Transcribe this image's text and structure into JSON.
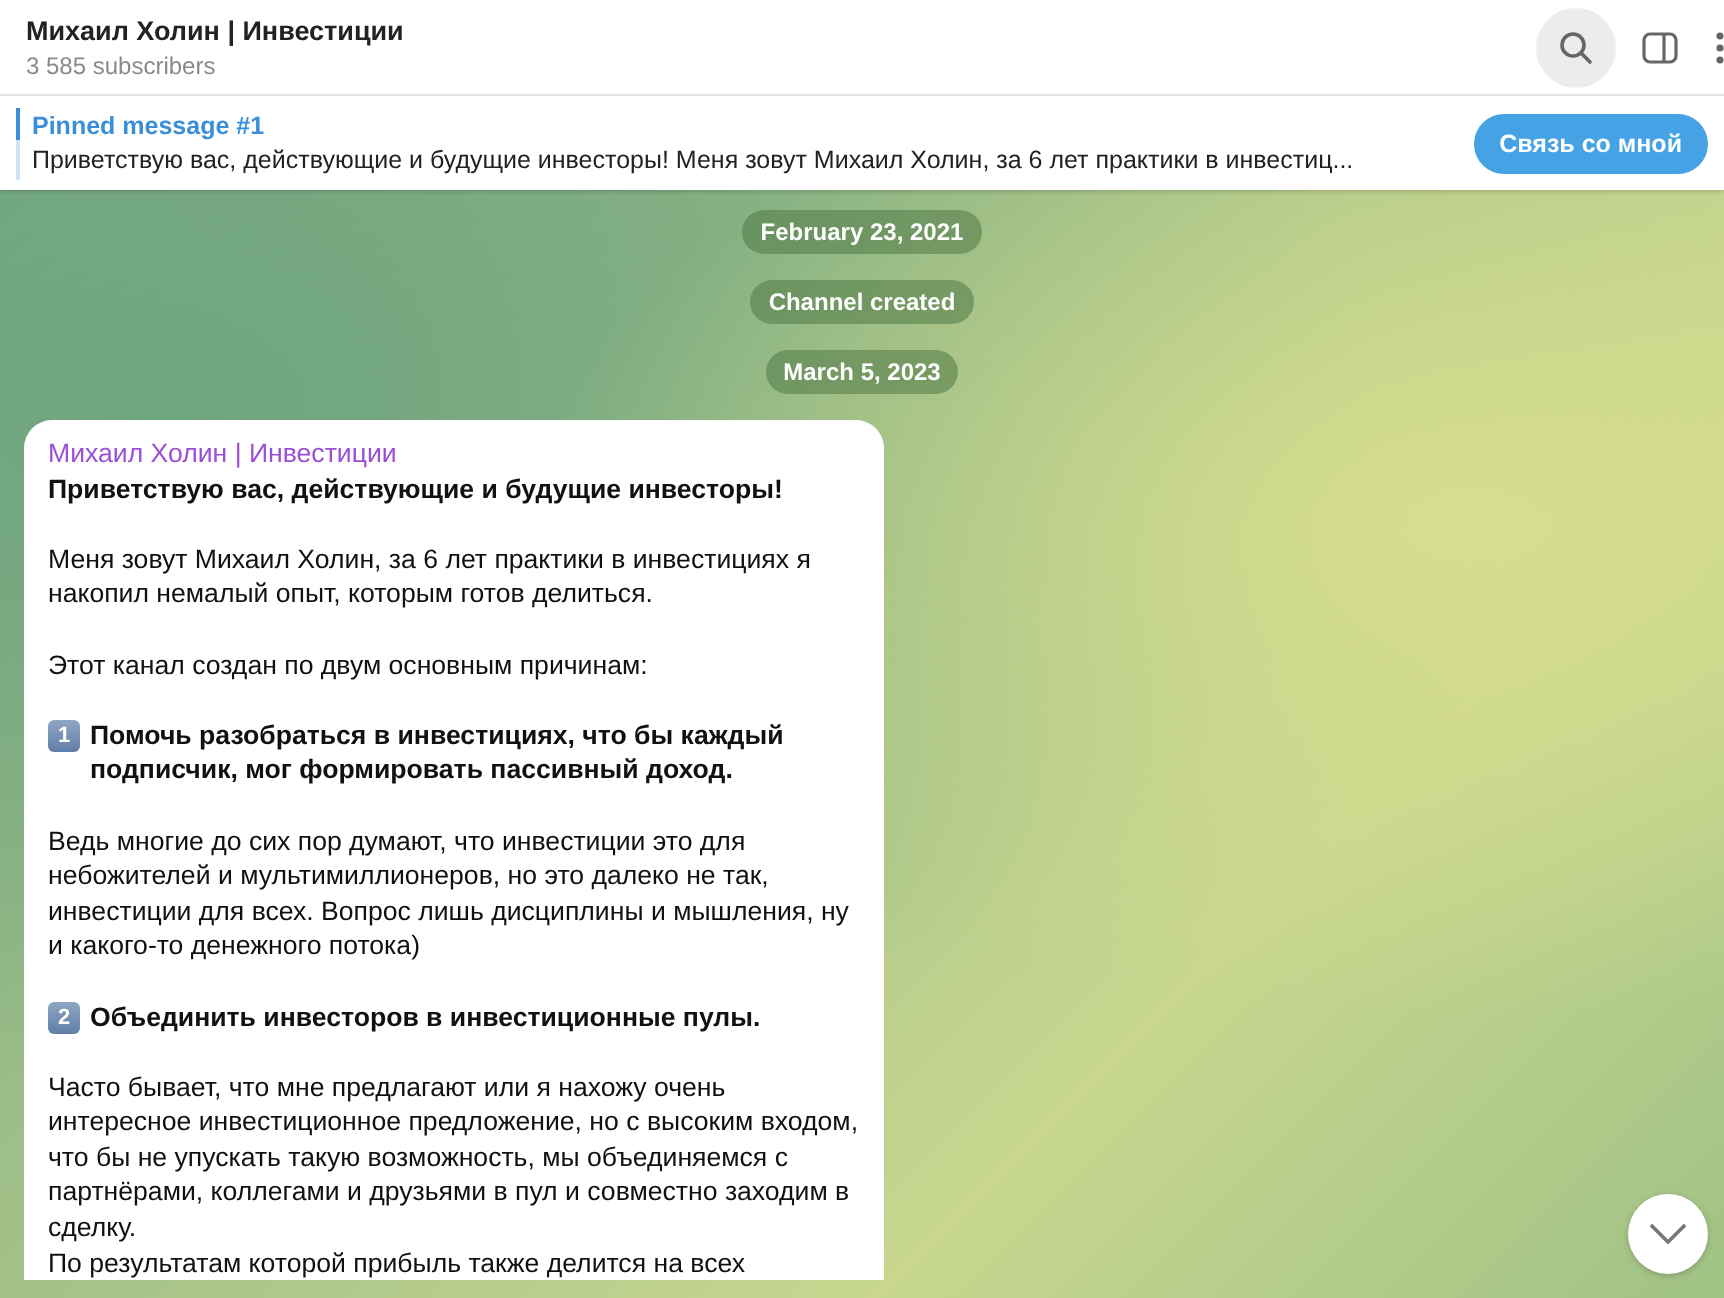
{
  "header": {
    "title": "Михаил Холин | Инвестиции",
    "subtitle": "3 585 subscribers",
    "search_active": true
  },
  "pinned": {
    "title": "Pinned message #1",
    "text": "Приветствую вас, действующие и будущие инвесторы!  Меня зовут Михаил Холин, за 6 лет практики в инвестиц...",
    "button": "Связь со мной"
  },
  "service_messages": [
    "February 23, 2021",
    "Channel created",
    "March 5, 2023"
  ],
  "message": {
    "author": "Михаил Холин | Инвестиции",
    "paragraphs": [
      {
        "kind": "bold",
        "text": "Приветствую вас, действующие и будущие инвесторы!"
      },
      {
        "kind": "text",
        "text": "Меня зовут Михаил Холин, за 6 лет практики в инвестициях я накопил немалый опыт, которым готов делиться."
      },
      {
        "kind": "text",
        "text": "Этот канал создан по двум основным причинам:"
      },
      {
        "kind": "numbered",
        "number": "1",
        "text": "Помочь разобраться в инвестициях, что бы каждый подписчик, мог формировать пассивный доход."
      },
      {
        "kind": "text",
        "text": "Ведь многие до сих пор думают, что инвестиции это для небожителей и  мультимиллионеров, но это далеко не так, инвестиции для всех. Вопрос лишь дисциплины и мышления, ну и какого-то денежного потока)"
      },
      {
        "kind": "numbered",
        "number": "2",
        "text": "Объединить инвесторов в инвестиционные пулы."
      },
      {
        "kind": "text",
        "text": "Часто бывает, что мне предлагают или я нахожу очень интересное инвестиционное предложение, но с высоким входом, что бы не упускать такую возможность, мы объединяемся с партнёрами, коллегами и друзьями в пул и совместно заходим в сделку.\nПо результатам которой прибыль также делится на всех"
      }
    ]
  }
}
